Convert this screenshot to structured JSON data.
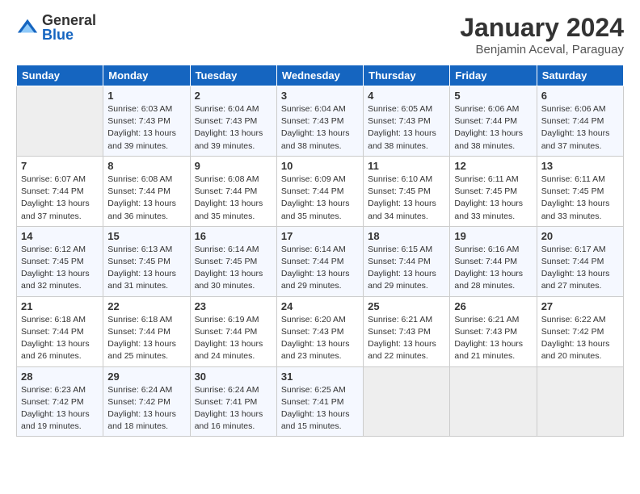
{
  "logo": {
    "general": "General",
    "blue": "Blue"
  },
  "title": "January 2024",
  "subtitle": "Benjamin Aceval, Paraguay",
  "days_of_week": [
    "Sunday",
    "Monday",
    "Tuesday",
    "Wednesday",
    "Thursday",
    "Friday",
    "Saturday"
  ],
  "weeks": [
    [
      {
        "day": "",
        "sunrise": "",
        "sunset": "",
        "daylight": ""
      },
      {
        "day": "1",
        "sunrise": "6:03 AM",
        "sunset": "7:43 PM",
        "daylight": "13 hours and 39 minutes."
      },
      {
        "day": "2",
        "sunrise": "6:04 AM",
        "sunset": "7:43 PM",
        "daylight": "13 hours and 39 minutes."
      },
      {
        "day": "3",
        "sunrise": "6:04 AM",
        "sunset": "7:43 PM",
        "daylight": "13 hours and 38 minutes."
      },
      {
        "day": "4",
        "sunrise": "6:05 AM",
        "sunset": "7:43 PM",
        "daylight": "13 hours and 38 minutes."
      },
      {
        "day": "5",
        "sunrise": "6:06 AM",
        "sunset": "7:44 PM",
        "daylight": "13 hours and 38 minutes."
      },
      {
        "day": "6",
        "sunrise": "6:06 AM",
        "sunset": "7:44 PM",
        "daylight": "13 hours and 37 minutes."
      }
    ],
    [
      {
        "day": "7",
        "sunrise": "6:07 AM",
        "sunset": "7:44 PM",
        "daylight": "13 hours and 37 minutes."
      },
      {
        "day": "8",
        "sunrise": "6:08 AM",
        "sunset": "7:44 PM",
        "daylight": "13 hours and 36 minutes."
      },
      {
        "day": "9",
        "sunrise": "6:08 AM",
        "sunset": "7:44 PM",
        "daylight": "13 hours and 35 minutes."
      },
      {
        "day": "10",
        "sunrise": "6:09 AM",
        "sunset": "7:44 PM",
        "daylight": "13 hours and 35 minutes."
      },
      {
        "day": "11",
        "sunrise": "6:10 AM",
        "sunset": "7:45 PM",
        "daylight": "13 hours and 34 minutes."
      },
      {
        "day": "12",
        "sunrise": "6:11 AM",
        "sunset": "7:45 PM",
        "daylight": "13 hours and 33 minutes."
      },
      {
        "day": "13",
        "sunrise": "6:11 AM",
        "sunset": "7:45 PM",
        "daylight": "13 hours and 33 minutes."
      }
    ],
    [
      {
        "day": "14",
        "sunrise": "6:12 AM",
        "sunset": "7:45 PM",
        "daylight": "13 hours and 32 minutes."
      },
      {
        "day": "15",
        "sunrise": "6:13 AM",
        "sunset": "7:45 PM",
        "daylight": "13 hours and 31 minutes."
      },
      {
        "day": "16",
        "sunrise": "6:14 AM",
        "sunset": "7:45 PM",
        "daylight": "13 hours and 30 minutes."
      },
      {
        "day": "17",
        "sunrise": "6:14 AM",
        "sunset": "7:44 PM",
        "daylight": "13 hours and 29 minutes."
      },
      {
        "day": "18",
        "sunrise": "6:15 AM",
        "sunset": "7:44 PM",
        "daylight": "13 hours and 29 minutes."
      },
      {
        "day": "19",
        "sunrise": "6:16 AM",
        "sunset": "7:44 PM",
        "daylight": "13 hours and 28 minutes."
      },
      {
        "day": "20",
        "sunrise": "6:17 AM",
        "sunset": "7:44 PM",
        "daylight": "13 hours and 27 minutes."
      }
    ],
    [
      {
        "day": "21",
        "sunrise": "6:18 AM",
        "sunset": "7:44 PM",
        "daylight": "13 hours and 26 minutes."
      },
      {
        "day": "22",
        "sunrise": "6:18 AM",
        "sunset": "7:44 PM",
        "daylight": "13 hours and 25 minutes."
      },
      {
        "day": "23",
        "sunrise": "6:19 AM",
        "sunset": "7:44 PM",
        "daylight": "13 hours and 24 minutes."
      },
      {
        "day": "24",
        "sunrise": "6:20 AM",
        "sunset": "7:43 PM",
        "daylight": "13 hours and 23 minutes."
      },
      {
        "day": "25",
        "sunrise": "6:21 AM",
        "sunset": "7:43 PM",
        "daylight": "13 hours and 22 minutes."
      },
      {
        "day": "26",
        "sunrise": "6:21 AM",
        "sunset": "7:43 PM",
        "daylight": "13 hours and 21 minutes."
      },
      {
        "day": "27",
        "sunrise": "6:22 AM",
        "sunset": "7:42 PM",
        "daylight": "13 hours and 20 minutes."
      }
    ],
    [
      {
        "day": "28",
        "sunrise": "6:23 AM",
        "sunset": "7:42 PM",
        "daylight": "13 hours and 19 minutes."
      },
      {
        "day": "29",
        "sunrise": "6:24 AM",
        "sunset": "7:42 PM",
        "daylight": "13 hours and 18 minutes."
      },
      {
        "day": "30",
        "sunrise": "6:24 AM",
        "sunset": "7:41 PM",
        "daylight": "13 hours and 16 minutes."
      },
      {
        "day": "31",
        "sunrise": "6:25 AM",
        "sunset": "7:41 PM",
        "daylight": "13 hours and 15 minutes."
      },
      {
        "day": "",
        "sunrise": "",
        "sunset": "",
        "daylight": ""
      },
      {
        "day": "",
        "sunrise": "",
        "sunset": "",
        "daylight": ""
      },
      {
        "day": "",
        "sunrise": "",
        "sunset": "",
        "daylight": ""
      }
    ]
  ]
}
